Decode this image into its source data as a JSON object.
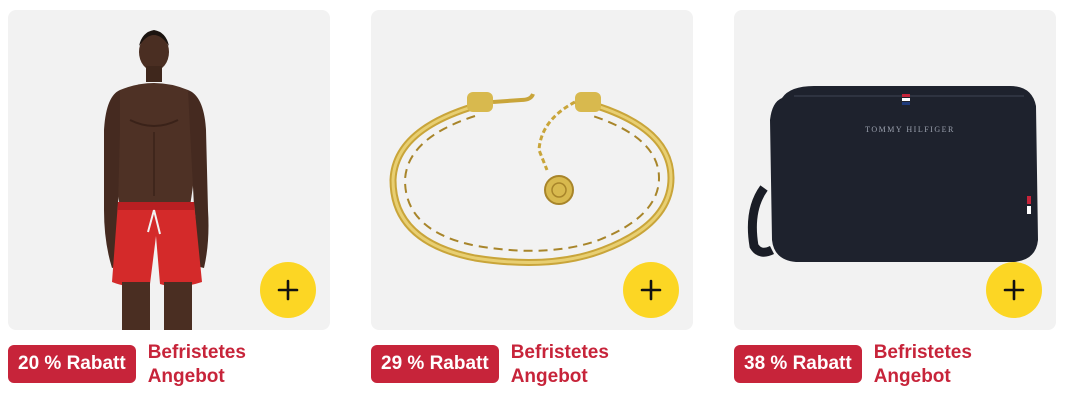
{
  "products": [
    {
      "discount": "20 % Rabatt",
      "deal_line1": "Befristetes",
      "deal_line2": "Angebot",
      "image": "swim-shorts-model",
      "add_icon": "plus-icon"
    },
    {
      "discount": "29 % Rabatt",
      "deal_line1": "Befristetes",
      "deal_line2": "Angebot",
      "image": "gold-chain-bracelet",
      "add_icon": "plus-icon"
    },
    {
      "discount": "38 % Rabatt",
      "deal_line1": "Befristetes",
      "deal_line2": "Angebot",
      "image": "black-toiletry-bag",
      "add_icon": "plus-icon",
      "bag_brand_text": "TOMMY HILFIGER"
    }
  ],
  "colors": {
    "badge": "#c7243a",
    "add_button": "#fcd624",
    "card_bg": "#f2f2f2"
  }
}
